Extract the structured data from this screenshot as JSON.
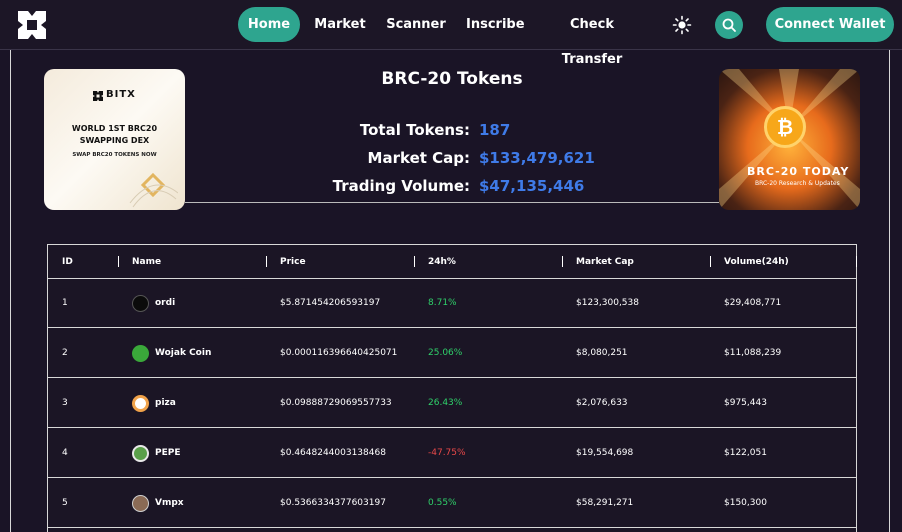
{
  "nav": {
    "items": [
      {
        "label": "Home",
        "active": true
      },
      {
        "label": "Market",
        "active": false
      },
      {
        "label": "Scanner",
        "active": false
      },
      {
        "label": "Inscribe",
        "active": false
      },
      {
        "label": "Check Transfer",
        "active": false
      }
    ],
    "connect_label": "Connect Wallet",
    "icons": [
      "logo-icon",
      "sun-icon",
      "search-icon"
    ],
    "accent": "#2ea58f"
  },
  "banner_left": {
    "brand": "BITX",
    "title": "WORLD 1ST BRC20 SWAPPING DEX",
    "subtitle": "SWAP BRC20 TOKENS NOW"
  },
  "hero": {
    "title": "BRC-20 Tokens",
    "stats": [
      {
        "label": "Total Tokens:",
        "value": "187"
      },
      {
        "label": "Market Cap:",
        "value": "$133,479,621"
      },
      {
        "label": "Trading Volume:",
        "value": "$47,135,446"
      }
    ],
    "value_color": "#3f7be8"
  },
  "banner_right": {
    "title": "BRC-20 TODAY",
    "subtitle": "BRC-20 Research & Updates"
  },
  "table": {
    "columns": [
      "ID",
      "Name",
      "Price",
      "24h%",
      "Market Cap",
      "Volume(24h)"
    ],
    "rows": [
      {
        "id": "1",
        "name": "ordi",
        "price": "$5.871454206593197",
        "change": "8.71%",
        "trend": "up",
        "mcap": "$123,300,538",
        "volume": "$29,408,771",
        "icon_color": "#0b0b0b"
      },
      {
        "id": "2",
        "name": "Wojak Coin",
        "price": "$0.000116396640425071",
        "change": "25.06%",
        "trend": "up",
        "mcap": "$8,080,251",
        "volume": "$11,088,239",
        "icon_color": "#3aa83a"
      },
      {
        "id": "3",
        "name": "piza",
        "price": "$0.09888729069557733",
        "change": "26.43%",
        "trend": "up",
        "mcap": "$2,076,633",
        "volume": "$975,443",
        "icon_color": "#f0a24a"
      },
      {
        "id": "4",
        "name": "PEPE",
        "price": "$0.4648244003138468",
        "change": "-47.75%",
        "trend": "down",
        "mcap": "$19,554,698",
        "volume": "$122,051",
        "icon_color": "#5aa04a"
      },
      {
        "id": "5",
        "name": "Vmpx",
        "price": "$0.5366334377603197",
        "change": "0.55%",
        "trend": "up",
        "mcap": "$58,291,271",
        "volume": "$150,300",
        "icon_color": "#8a6a55"
      }
    ],
    "colors": {
      "up": "#2fd06a",
      "down": "#e84848"
    }
  }
}
